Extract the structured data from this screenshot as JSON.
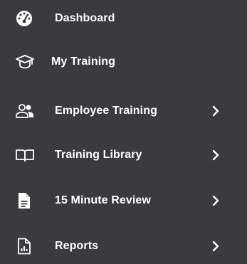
{
  "nav": {
    "items": [
      {
        "label": "Dashboard",
        "icon": "dashboard-gauge-icon",
        "has_submenu": false
      },
      {
        "label": "My Training",
        "icon": "graduation-cap-icon",
        "has_submenu": false
      },
      {
        "label": "Employee Training",
        "icon": "users-icon",
        "has_submenu": true
      },
      {
        "label": "Training Library",
        "icon": "open-book-icon",
        "has_submenu": true
      },
      {
        "label": "15 Minute Review",
        "icon": "document-icon",
        "has_submenu": true
      },
      {
        "label": "Reports",
        "icon": "report-chart-icon",
        "has_submenu": true
      }
    ]
  },
  "colors": {
    "background": "#3b3a3e",
    "text": "#ffffff",
    "icon": "#ffffff"
  }
}
